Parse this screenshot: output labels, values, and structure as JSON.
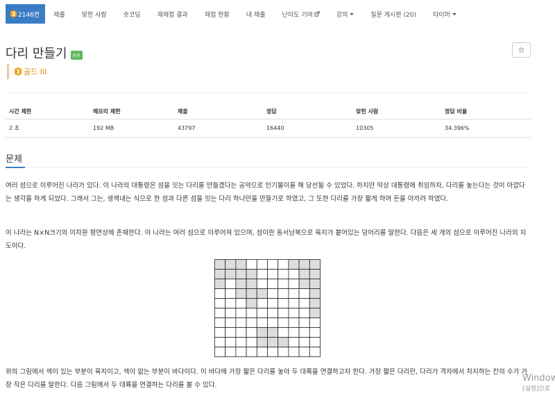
{
  "nav": {
    "problem_number": "2146번",
    "tier_level": "3",
    "items": [
      {
        "label": "제출"
      },
      {
        "label": "맞힌 사람"
      },
      {
        "label": "숏코딩"
      },
      {
        "label": "재채점 결과"
      },
      {
        "label": "채점 현황"
      },
      {
        "label": "내 제출"
      },
      {
        "label": "난이도 기여"
      },
      {
        "label": "강의"
      },
      {
        "label": "질문 게시판 (20)"
      },
      {
        "label": "타이머"
      }
    ]
  },
  "problem": {
    "title": "다리 만들기",
    "status_badge": "성공",
    "tier_label": "골드 III",
    "tier_level": "3",
    "star": "☆"
  },
  "colors": {
    "accent": "#3b7dc4",
    "success": "#5cb85c",
    "gold": "#f0a020",
    "land": "#dddddd"
  },
  "info_table": {
    "headers": [
      "시간 제한",
      "메모리 제한",
      "제출",
      "정답",
      "맞힌 사람",
      "정답 비율"
    ],
    "row": [
      "2 초",
      "192 MB",
      "43797",
      "16440",
      "10305",
      "34.396%"
    ]
  },
  "section": {
    "title": "문제"
  },
  "description": {
    "p1": "여러 섬으로 이루어진 나라가 있다. 이 나라의 대통령은 섬을 잇는 다리를 만들겠다는 공약으로 인기몰이를 해 당선될 수 있었다. 하지만 막상 대통령에 취임하자, 다리를 놓는다는 것이 아깝다는 생각을 하게 되었다. 그래서 그는, 생색내는 식으로 한 섬과 다른 섬을 잇는 다리 하나만을 만들기로 하였고, 그 또한 다리를 가장 짧게 하여 돈을 아끼려 하였다.",
    "p2": "이 나라는 N×N크기의 이차원 평면상에 존재한다. 이 나라는 여러 섬으로 이루어져 있으며, 섬이란 동서남북으로 육지가 붙어있는 덩어리를 말한다. 다음은 세 개의 섬으로 이루어진 나라의 지도이다.",
    "p3": "위의 그림에서 색이 있는 부분이 육지이고, 색이 없는 부분이 바다이다. 이 바다에 가장 짧은 다리를 놓아 두 대륙을 연결하고자 한다. 가장 짧은 다리란, 다리가 격자에서 차지하는 칸의 수가 가장 작은 다리를 말한다. 다음 그림에서 두 대륙을 연결하는 다리를 볼 수 있다."
  },
  "map": {
    "size": 10,
    "land": [
      [
        1,
        1,
        1,
        0,
        0,
        0,
        0,
        1,
        1,
        1
      ],
      [
        1,
        1,
        1,
        1,
        0,
        0,
        0,
        0,
        1,
        1
      ],
      [
        1,
        0,
        1,
        1,
        0,
        0,
        0,
        0,
        1,
        1
      ],
      [
        0,
        0,
        1,
        1,
        1,
        0,
        0,
        0,
        0,
        1
      ],
      [
        0,
        0,
        0,
        1,
        0,
        0,
        0,
        0,
        0,
        1
      ],
      [
        0,
        0,
        0,
        0,
        0,
        0,
        0,
        0,
        0,
        1
      ],
      [
        0,
        0,
        0,
        0,
        0,
        0,
        0,
        0,
        0,
        0
      ],
      [
        0,
        0,
        0,
        0,
        1,
        1,
        0,
        0,
        0,
        0
      ],
      [
        0,
        0,
        0,
        0,
        1,
        1,
        1,
        0,
        0,
        0
      ],
      [
        0,
        0,
        0,
        0,
        0,
        0,
        0,
        0,
        0,
        0
      ]
    ]
  },
  "watermark": {
    "line1": "Window",
    "line2": "[설정]으로"
  }
}
